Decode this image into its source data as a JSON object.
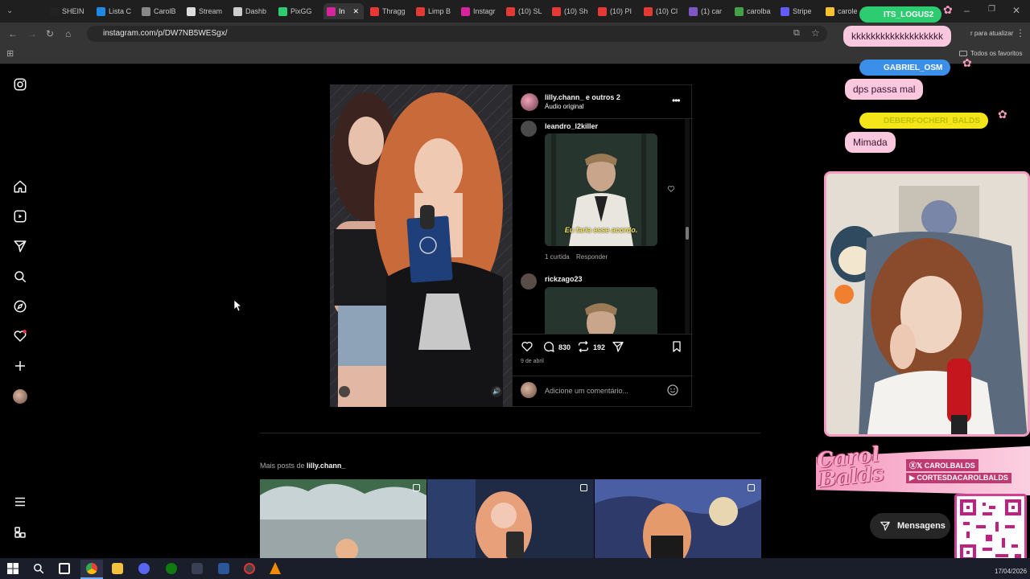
{
  "browser": {
    "tabs": [
      {
        "label": "SHEIN",
        "color": "#222"
      },
      {
        "label": "Lista C",
        "color": "#1e88e5"
      },
      {
        "label": "CarolB",
        "color": "#888"
      },
      {
        "label": "Stream",
        "color": "#ddd"
      },
      {
        "label": "Dashb",
        "color": "#ccc"
      },
      {
        "label": "PixGG",
        "color": "#2ecc71"
      },
      {
        "label": "In",
        "color": "#d6249f"
      },
      {
        "label": "Thragg",
        "color": "#e53935"
      },
      {
        "label": "Limp B",
        "color": "#e53935"
      },
      {
        "label": "Instagr",
        "color": "#d6249f"
      },
      {
        "label": "(10) SL",
        "color": "#e53935"
      },
      {
        "label": "(10) Sh",
        "color": "#e53935"
      },
      {
        "label": "(10) PI",
        "color": "#e53935"
      },
      {
        "label": "(10) Cl",
        "color": "#e53935"
      },
      {
        "label": "(1) car",
        "color": "#7e57c2"
      },
      {
        "label": "carolba",
        "color": "#43a047"
      },
      {
        "label": "Stripe",
        "color": "#635bff"
      },
      {
        "label": "carole",
        "color": "#fbc02d"
      }
    ],
    "url": "instagram.com/p/DW7NB5WESgx/",
    "update_label": "r para atualizar",
    "favorites_label": "Todos os favoritos"
  },
  "post": {
    "header_user": "lilly.chann_",
    "header_others": " e outros 2",
    "audio": "Áudio original",
    "comments": [
      {
        "user": "leandro_l2killer",
        "meme_caption": "Eu faria esse acordo.",
        "likes": "1 curtida",
        "reply": "Responder"
      },
      {
        "user": "rickzago23"
      }
    ],
    "comment_count": "830",
    "repost_count": "192",
    "date": "9 de abril",
    "comment_placeholder": "Adicione um comentário..."
  },
  "more_posts": {
    "prefix": "Mais posts de ",
    "user": "lilly.chann_"
  },
  "stream": {
    "chat": [
      {
        "name": "ITS_LOGUS2",
        "message": "kkkkkkkkkkkkkkkkkkk",
        "name_color": "#2ecc71"
      },
      {
        "name": "GABRIEL_OSM",
        "message": "dps passa mal",
        "name_color": "#3b8fe8"
      },
      {
        "name": "DEBERFOCHERI_BALDS",
        "message": "Mimada",
        "name_color": "#f4e51a"
      }
    ],
    "brand": "Carol Balds",
    "socials": [
      "CAROLBALDS",
      "CORTESDACAROLBALDS"
    ],
    "messages_button": "Mensagens"
  },
  "taskbar": {
    "date": "17/04/2026"
  }
}
